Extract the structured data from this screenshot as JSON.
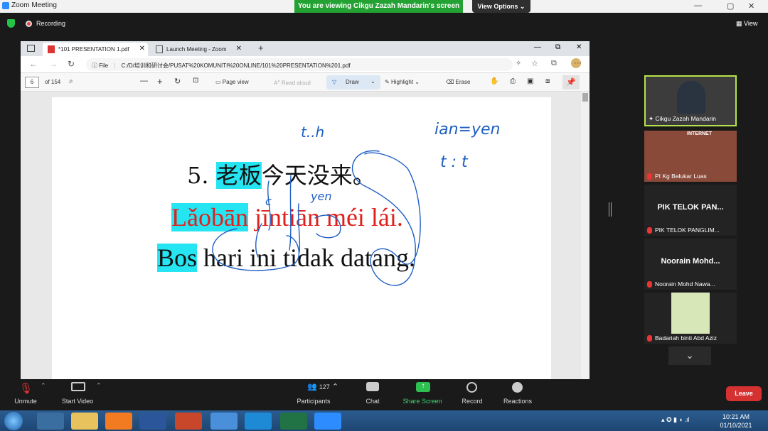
{
  "zoom": {
    "window_title": "Zoom Meeting",
    "banner": "You are viewing Cikgu Zazah Mandarin's screen",
    "view_options": "View Options",
    "recording": "Recording",
    "view": "View"
  },
  "browser": {
    "tabs": [
      {
        "label": "*101 PRESENTATION 1.pdf"
      },
      {
        "label": "Launch Meeting - Zoom"
      }
    ],
    "file_label": "File",
    "url": "C:/D/培训和研讨会/PUSAT%20KOMUNITI%20ONLINE/101%20PRESENTATION%201.pdf"
  },
  "pdf_toolbar": {
    "page": "6",
    "of_pages": "of 154",
    "page_view": "Page view",
    "read_aloud": "Read aloud",
    "draw": "Draw",
    "highlight": "Highlight",
    "erase": "Erase"
  },
  "slide": {
    "number": "5.",
    "hanzi_highlight": "老板",
    "hanzi_rest": "今天没来。",
    "pinyin_highlight": "Lǎobān",
    "pinyin_rest": " jīntiān méi lái.",
    "malay_highlight": "Bos",
    "malay_rest": " hari ini tidak datang."
  },
  "handwriting": {
    "t_h": "t..h",
    "ian_yen": "ian=yen",
    "t_t": "t : t",
    "yen": "yen",
    "c": "c"
  },
  "participants": [
    {
      "name": "Cikgu Zazah Mandarin",
      "big": ""
    },
    {
      "name": "PI Kg Belukar Luas",
      "big": "",
      "banner": "INTERNET"
    },
    {
      "name": "PIK TELOK PANGLIM...",
      "big": "PIK TELOK PAN..."
    },
    {
      "name": "Noorain Mohd Nawa...",
      "big": "Noorain  Mohd..."
    },
    {
      "name": "Badariah binti Abd Aziz",
      "big": ""
    }
  ],
  "controls": {
    "unmute": "Unmute",
    "start_video": "Start Video",
    "participants": "Participants",
    "participant_count": "127",
    "chat": "Chat",
    "share_screen": "Share Screen",
    "record": "Record",
    "reactions": "Reactions",
    "leave": "Leave"
  },
  "taskbar": {
    "time": "10:21 AM",
    "date": "01/10/2021"
  },
  "colors": {
    "highlight_cyan": "#26e5f2",
    "pinyin_red": "#e0201c",
    "ink_blue": "#1f5fc4",
    "banner_green": "#23a233",
    "leave_red": "#d63131"
  }
}
